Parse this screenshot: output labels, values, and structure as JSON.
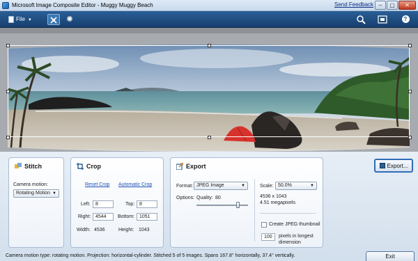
{
  "window": {
    "title": "Microsoft Image Composite Editor - Muggy Muggy Beach",
    "send_feedback": "Send Feedback",
    "minimize": "–",
    "maximize": "▢",
    "close": "✕"
  },
  "toolbar": {
    "file_label": "File",
    "icons": [
      "stitch-icon",
      "gear-icon",
      "zoom-icon",
      "fit-icon",
      "help-icon"
    ]
  },
  "stitch": {
    "title": "Stitch",
    "camera_motion_label": "Camera motion:",
    "camera_motion_value": "Rotating Motion"
  },
  "crop": {
    "title": "Crop",
    "reset_crop": "Reset Crop",
    "automatic_crop": "Automatic Crop",
    "left_label": "Left:",
    "left_value": "8",
    "top_label": "Top:",
    "top_value": "8",
    "right_label": "Right:",
    "right_value": "4544",
    "bottom_label": "Bottom:",
    "bottom_value": "1051",
    "width_label": "Width:",
    "width_value": "4536",
    "height_label": "Height:",
    "height_value": "1043"
  },
  "export": {
    "title": "Export",
    "format_label": "Format:",
    "format_value": "JPEG Image",
    "options_label": "Options:",
    "quality_label": "Quality:",
    "quality_value": "80",
    "quality_fraction": 0.8,
    "scale_label": "Scale:",
    "scale_value": "50.0%",
    "dimensions": "4536 x 1043",
    "megapixels": "4.51 megapixels",
    "thumbnail_label": "Create JPEG thumbnail",
    "thumbnail_size": "100",
    "thumbnail_desc_1": "pixels in longest",
    "thumbnail_desc_2": "dimension",
    "export_button": "Export..."
  },
  "status": {
    "text": "Camera motion type: rotating motion. Projection: horizontal-cylinder. Stitched 5 of 5 images. Spans 167.8° horizontally, 37.4° vertically."
  },
  "footer": {
    "exit_button": "Exit"
  }
}
